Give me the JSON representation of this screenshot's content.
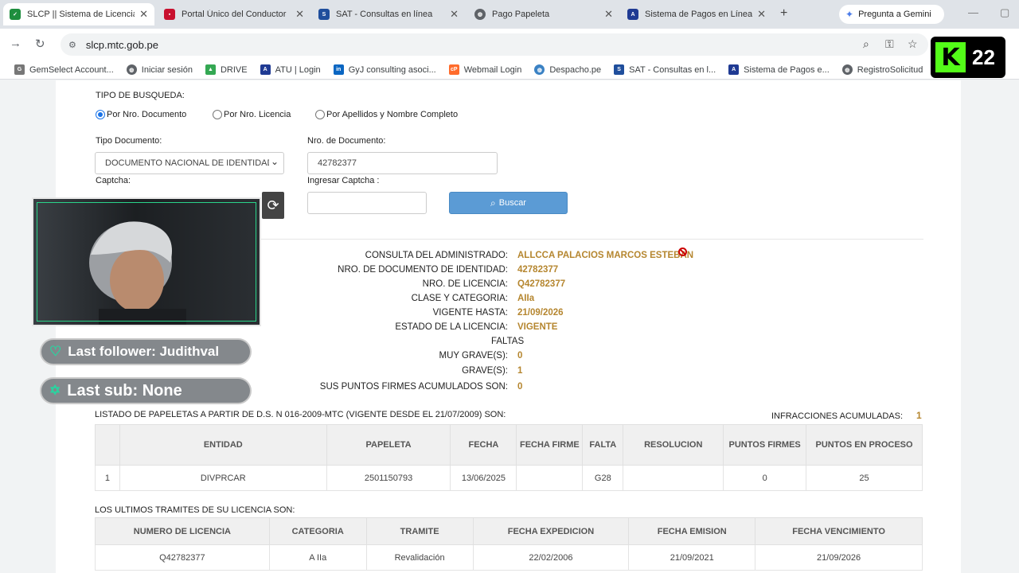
{
  "browser": {
    "tabs": [
      {
        "title": "SLCP || Sistema de Licencias",
        "icon": "shield-check-icon",
        "color": "#1e8e3e"
      },
      {
        "title": "Portal Único del Conductor",
        "icon": "flag-peru-icon",
        "color": "#c8102e"
      },
      {
        "title": "SAT - Consultas en línea",
        "icon": "sat-logo-icon",
        "color": "#1f4e9c"
      },
      {
        "title": "Pago Papeleta",
        "icon": "globe-icon",
        "color": "#5f6368"
      },
      {
        "title": "Sistema de Pagos en Línea",
        "icon": "atu-logo-icon",
        "color": "#1f3a93"
      }
    ],
    "gemini_label": "Pregunta a Gemini",
    "url": "slcp.mtc.gob.pe",
    "bookmarks": [
      {
        "label": "GemSelect Account...",
        "icon": "gemselect-icon"
      },
      {
        "label": "Iniciar sesión",
        "icon": "globe-icon"
      },
      {
        "label": "DRIVE",
        "icon": "drive-icon"
      },
      {
        "label": "ATU | Login",
        "icon": "atu-logo-icon"
      },
      {
        "label": "GyJ consulting asoci...",
        "icon": "linkedin-icon"
      },
      {
        "label": "Webmail Login",
        "icon": "cpanel-icon"
      },
      {
        "label": "Despacho.pe",
        "icon": "globe-icon"
      },
      {
        "label": "SAT - Consultas en l...",
        "icon": "sat-logo-icon"
      },
      {
        "label": "Sistema de Pagos e...",
        "icon": "atu-logo-icon"
      },
      {
        "label": "RegistroSolicitud",
        "icon": "globe-icon"
      }
    ]
  },
  "search": {
    "tipo_busqueda_label": "TIPO DE BUSQUEDA:",
    "options": [
      "Por Nro. Documento",
      "Por Nro. Licencia",
      "Por Apellidos y Nombre Completo"
    ],
    "selected_option": "Por Nro. Documento",
    "tipo_documento_label": "Tipo Documento:",
    "tipo_documento_value": "DOCUMENTO NACIONAL DE IDENTIDAD",
    "nro_documento_label": "Nro. de Documento:",
    "nro_documento_value": "42782377",
    "captcha_label": "Captcha:",
    "ingresar_captcha_label": "Ingresar Captcha :",
    "ingresar_captcha_value": "",
    "buscar_label": "Buscar"
  },
  "result": {
    "rows": [
      {
        "key": "CONSULTA DEL ADMINISTRADO:",
        "value": "ALLCCA PALACIOS MARCOS ESTEBAN"
      },
      {
        "key": "NRO. DE DOCUMENTO DE IDENTIDAD:",
        "value": "42782377"
      },
      {
        "key": "NRO. DE LICENCIA:",
        "value": "Q42782377"
      },
      {
        "key": "CLASE Y CATEGORIA:",
        "value": "AIIa"
      },
      {
        "key": "VIGENTE HASTA:",
        "value": "21/09/2026"
      },
      {
        "key": "ESTADO DE LA LICENCIA:",
        "value": "VIGENTE"
      }
    ],
    "faltas_label": "FALTAS",
    "faltas_rows": [
      {
        "key": "MUY GRAVE(S):",
        "value": "0"
      },
      {
        "key": "GRAVE(S):",
        "value": "1"
      },
      {
        "key": "SUS PUNTOS FIRMES ACUMULADOS SON:",
        "value": "0"
      }
    ]
  },
  "papeletas": {
    "title": "LISTADO DE PAPELETAS A PARTIR DE D.S. N 016-2009-MTC (VIGENTE DESDE EL 21/07/2009) SON:",
    "infracciones_label": "INFRACCIONES ACUMULADAS:",
    "infracciones_value": "1",
    "headers": [
      "",
      "ENTIDAD",
      "PAPELETA",
      "FECHA",
      "FECHA FIRME",
      "FALTA",
      "RESOLUCION",
      "PUNTOS FIRMES",
      "PUNTOS EN PROCESO"
    ],
    "rows": [
      [
        "1",
        "DIVPRCAR",
        "2501150793",
        "13/06/2025",
        "",
        "G28",
        "",
        "0",
        "25"
      ]
    ]
  },
  "tramites": {
    "title": "LOS ULTIMOS TRAMITES DE SU LICENCIA SON:",
    "headers": [
      "NUMERO DE LICENCIA",
      "CATEGORIA",
      "TRAMITE",
      "FECHA EXPEDICION",
      "FECHA EMISION",
      "FECHA VENCIMIENTO"
    ],
    "rows": [
      [
        "Q42782377",
        "A IIa",
        "Revalidación",
        "22/02/2006",
        "21/09/2021",
        "21/09/2026"
      ]
    ]
  },
  "overlay": {
    "last_follower": "Last follower: Judithval",
    "last_sub": "Last sub: None",
    "badge_number": "22",
    "accent": "#53fc18"
  }
}
